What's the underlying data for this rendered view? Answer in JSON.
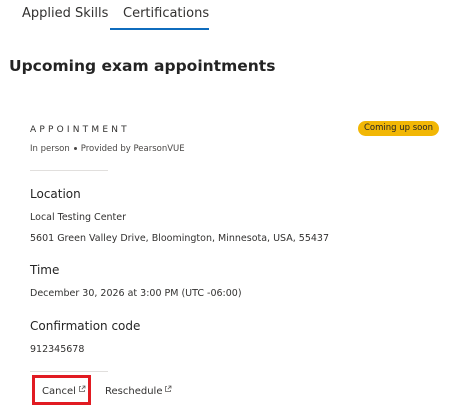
{
  "tabs": {
    "items": [
      {
        "label": "Applied Skills"
      },
      {
        "label": "Certifications"
      }
    ],
    "active": "Certifications"
  },
  "section": {
    "title": "Upcoming exam appointments"
  },
  "appointment": {
    "eyebrow": "APPOINTMENT",
    "mode": "In person",
    "provider": "Provided by PearsonVUE",
    "badge": "Coming up soon",
    "location_label": "Location",
    "location_name": "Local Testing Center",
    "address": "5601 Green Valley Drive, Bloomington, Minnesota, USA, 55437",
    "time_label": "Time",
    "time_value": "December 30, 2026 at 3:00 PM (UTC -06:00)",
    "code_label": "Confirmation code",
    "code_value": "912345678"
  },
  "actions": {
    "cancel_label": "Cancel",
    "reschedule_label": "Reschedule"
  },
  "icons": {
    "external_link": "external-link-icon"
  },
  "colors": {
    "accent": "#0f6cbd",
    "badge": "#f2b705",
    "highlight": "#e11b22"
  }
}
